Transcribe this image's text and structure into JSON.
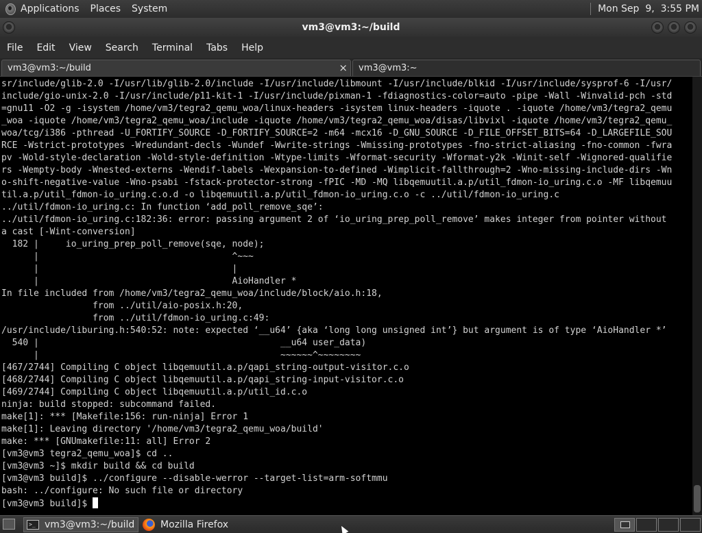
{
  "top_panel": {
    "menus": [
      "Applications",
      "Places",
      "System"
    ],
    "clock": "Mon Sep  9,  3:55 PM"
  },
  "window": {
    "title": "vm3@vm3:~/build"
  },
  "menubar": [
    "File",
    "Edit",
    "View",
    "Search",
    "Terminal",
    "Tabs",
    "Help"
  ],
  "tabs": [
    {
      "label": "vm3@vm3:~/build",
      "close": "×"
    },
    {
      "label": "vm3@vm3:~"
    }
  ],
  "terminal": {
    "lines": [
      "sr/include/glib-2.0 -I/usr/lib/glib-2.0/include -I/usr/include/libmount -I/usr/include/blkid -I/usr/include/sysprof-6 -I/usr/",
      "include/gio-unix-2.0 -I/usr/include/p11-kit-1 -I/usr/include/pixman-1 -fdiagnostics-color=auto -pipe -Wall -Winvalid-pch -std",
      "=gnu11 -O2 -g -isystem /home/vm3/tegra2_qemu_woa/linux-headers -isystem linux-headers -iquote . -iquote /home/vm3/tegra2_qemu",
      "_woa -iquote /home/vm3/tegra2_qemu_woa/include -iquote /home/vm3/tegra2_qemu_woa/disas/libvixl -iquote /home/vm3/tegra2_qemu_",
      "woa/tcg/i386 -pthread -U_FORTIFY_SOURCE -D_FORTIFY_SOURCE=2 -m64 -mcx16 -D_GNU_SOURCE -D_FILE_OFFSET_BITS=64 -D_LARGEFILE_SOU",
      "RCE -Wstrict-prototypes -Wredundant-decls -Wundef -Wwrite-strings -Wmissing-prototypes -fno-strict-aliasing -fno-common -fwra",
      "pv -Wold-style-declaration -Wold-style-definition -Wtype-limits -Wformat-security -Wformat-y2k -Winit-self -Wignored-qualifie",
      "rs -Wempty-body -Wnested-externs -Wendif-labels -Wexpansion-to-defined -Wimplicit-fallthrough=2 -Wno-missing-include-dirs -Wn",
      "o-shift-negative-value -Wno-psabi -fstack-protector-strong -fPIC -MD -MQ libqemuutil.a.p/util_fdmon-io_uring.c.o -MF libqemuu",
      "til.a.p/util_fdmon-io_uring.c.o.d -o libqemuutil.a.p/util_fdmon-io_uring.c.o -c ../util/fdmon-io_uring.c",
      "../util/fdmon-io_uring.c: In function ‘add_poll_remove_sqe’:",
      "../util/fdmon-io_uring.c:182:36: error: passing argument 2 of ‘io_uring_prep_poll_remove’ makes integer from pointer without",
      "a cast [-Wint-conversion]",
      "  182 |     io_uring_prep_poll_remove(sqe, node);",
      "      |                                    ^~~~",
      "      |                                    |",
      "      |                                    AioHandler *",
      "In file included from /home/vm3/tegra2_qemu_woa/include/block/aio.h:18,",
      "                 from ../util/aio-posix.h:20,",
      "                 from ../util/fdmon-io_uring.c:49:",
      "/usr/include/liburing.h:540:52: note: expected ‘__u64’ {aka ‘long long unsigned int’} but argument is of type ‘AioHandler *’",
      "  540 |                                             __u64 user_data)",
      "      |                                             ~~~~~~^~~~~~~~~",
      "[467/2744] Compiling C object libqemuutil.a.p/qapi_string-output-visitor.c.o",
      "[468/2744] Compiling C object libqemuutil.a.p/qapi_string-input-visitor.c.o",
      "[469/2744] Compiling C object libqemuutil.a.p/util_id.c.o",
      "ninja: build stopped: subcommand failed.",
      "make[1]: *** [Makefile:156: run-ninja] Error 1",
      "make[1]: Leaving directory '/home/vm3/tegra2_qemu_woa/build'",
      "make: *** [GNUmakefile:11: all] Error 2",
      "[vm3@vm3 tegra2_qemu_woa]$ cd ..",
      "[vm3@vm3 ~]$ mkdir build && cd build",
      "[vm3@vm3 build]$ ../configure --disable-werror --target-list=arm-softmmu",
      "bash: ../configure: No such file or directory"
    ],
    "prompt": "[vm3@vm3 build]$ "
  },
  "taskbar": {
    "items": [
      {
        "label": "vm3@vm3:~/build",
        "icon": "terminal-icon"
      },
      {
        "label": "Mozilla Firefox",
        "icon": "firefox-icon"
      }
    ]
  }
}
